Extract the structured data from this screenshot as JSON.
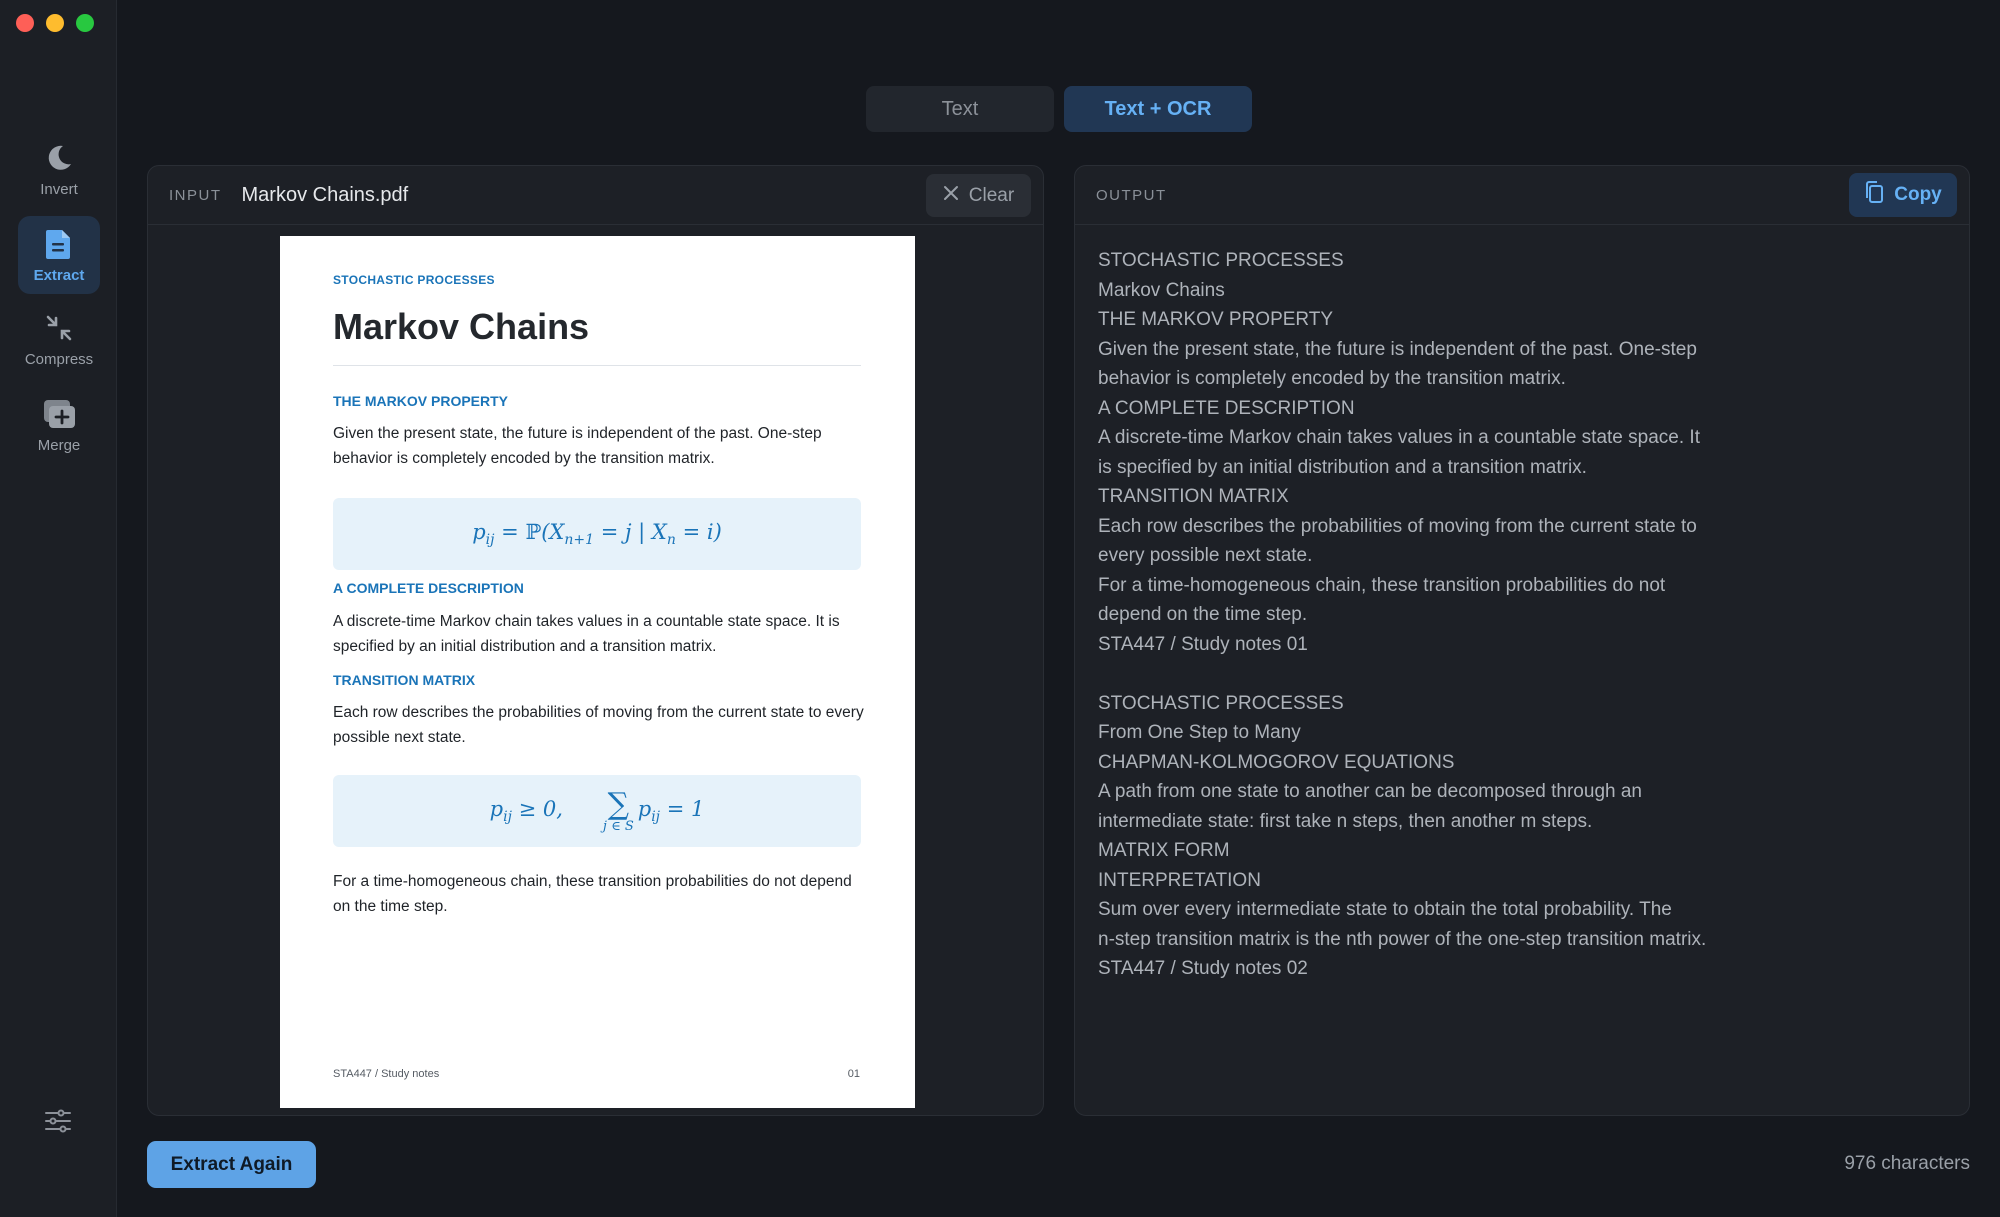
{
  "sidebar": {
    "items": [
      {
        "label": "Invert",
        "icon": "moon-icon"
      },
      {
        "label": "Extract",
        "icon": "document-icon",
        "active": true
      },
      {
        "label": "Compress",
        "icon": "compress-arrows-icon"
      },
      {
        "label": "Merge",
        "icon": "merge-stack-icon"
      }
    ],
    "settings_icon": "sliders-icon"
  },
  "mode_toggle": {
    "options": [
      "Text",
      "Text + OCR"
    ],
    "selected": "Text + OCR"
  },
  "input_panel": {
    "label": "INPUT",
    "file_name": "Markov Chains.pdf",
    "clear_label": "Clear",
    "page": {
      "kicker": "STOCHASTIC PROCESSES",
      "title": "Markov Chains",
      "section1_heading": "THE MARKOV PROPERTY",
      "section1_text": "Given the present state, the future is independent of the past. One-step behavior is completely encoded by the transition matrix.",
      "section2_heading": "A COMPLETE DESCRIPTION",
      "section2_text": "A discrete-time Markov chain takes values in a countable state space. It is specified by an initial distribution and a transition matrix.",
      "section3_heading": "TRANSITION MATRIX",
      "section3_text": "Each row describes the probabilities of moving from the current state to every possible next state.",
      "closing_text": "For a time-homogeneous chain, these transition probabilities do not depend on the time step.",
      "footer_left": "STA447  /  Study notes",
      "footer_right": "01"
    }
  },
  "output_panel": {
    "label": "OUTPUT",
    "copy_label": "Copy",
    "lines_page1": [
      "STOCHASTIC PROCESSES",
      "Markov Chains",
      "THE MARKOV PROPERTY",
      "Given the present state, the future is independent of the past. One-step",
      "behavior is completely encoded by the transition matrix.",
      "A COMPLETE DESCRIPTION",
      "A discrete-time Markov chain takes values in a countable state space. It",
      "is specified by an initial distribution and a transition matrix.",
      "TRANSITION MATRIX",
      "Each row describes the probabilities of moving from the current state to",
      "every possible next state.",
      "For a time-homogeneous chain, these transition probabilities do not",
      "depend on the time step.",
      "STA447 / Study notes 01"
    ],
    "lines_page2": [
      "STOCHASTIC PROCESSES",
      "From One Step to Many",
      "CHAPMAN-KOLMOGOROV EQUATIONS",
      "A path from one state to another can be decomposed through an",
      "intermediate state: first take n steps, then another m steps.",
      "MATRIX FORM",
      "INTERPRETATION",
      "Sum over every intermediate state to obtain the total probability. The",
      "n-step transition matrix is the nth power of the one-step transition matrix.",
      "STA447 / Study notes 02"
    ]
  },
  "footer": {
    "action_label": "Extract Again",
    "char_count": "976 characters"
  },
  "colors": {
    "accent": "#5ea3e6",
    "active_bg": "#213754",
    "background": "#15181e"
  }
}
